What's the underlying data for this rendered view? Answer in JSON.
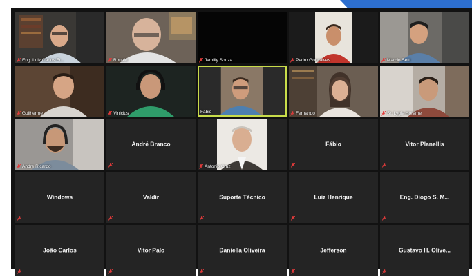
{
  "colors": {
    "accent": "#2d6fcf",
    "active_border": "#c8dc4a",
    "muted_mic": "#e23b3b",
    "tile_bg": "#242424",
    "grid_bg": "#121212"
  },
  "participants": [
    {
      "name": "Eng. Luiz Carlos Fr...",
      "video": true
    },
    {
      "name": "Ronald",
      "video": true
    },
    {
      "name": "Jamilly Souza",
      "video": false,
      "label_only": true
    },
    {
      "name": "Pedro Gonçalves",
      "video": true
    },
    {
      "name": "Marcio Setti",
      "video": true
    },
    {
      "name": "Guilherme",
      "video": true
    },
    {
      "name": "Vinicius",
      "video": true
    },
    {
      "name": "Fabio",
      "video": true,
      "active_speaker": true
    },
    {
      "name": "Fernando",
      "video": true
    },
    {
      "name": "Sr. Lygia Horame",
      "video": true
    },
    {
      "name": "Andre Ricardo",
      "video": true
    },
    {
      "name": "André Branco",
      "video": false
    },
    {
      "name": "Antonio Cruz",
      "video": true
    },
    {
      "name": "Fábio",
      "video": false
    },
    {
      "name": "Vitor Planellis",
      "video": false
    },
    {
      "name": "Windows",
      "video": false
    },
    {
      "name": "Valdir",
      "video": false
    },
    {
      "name": "Suporte Técnico",
      "video": false
    },
    {
      "name": "Luiz Henrique",
      "video": false
    },
    {
      "name": "Eng. Diogo S. M...",
      "video": false
    },
    {
      "name": "João Carlos",
      "video": false
    },
    {
      "name": "Vitor Palo",
      "video": false
    },
    {
      "name": "Daniella Oliveira",
      "video": false
    },
    {
      "name": "Jefferson",
      "video": false
    },
    {
      "name": "Gustavo H. Olive...",
      "video": false
    }
  ]
}
